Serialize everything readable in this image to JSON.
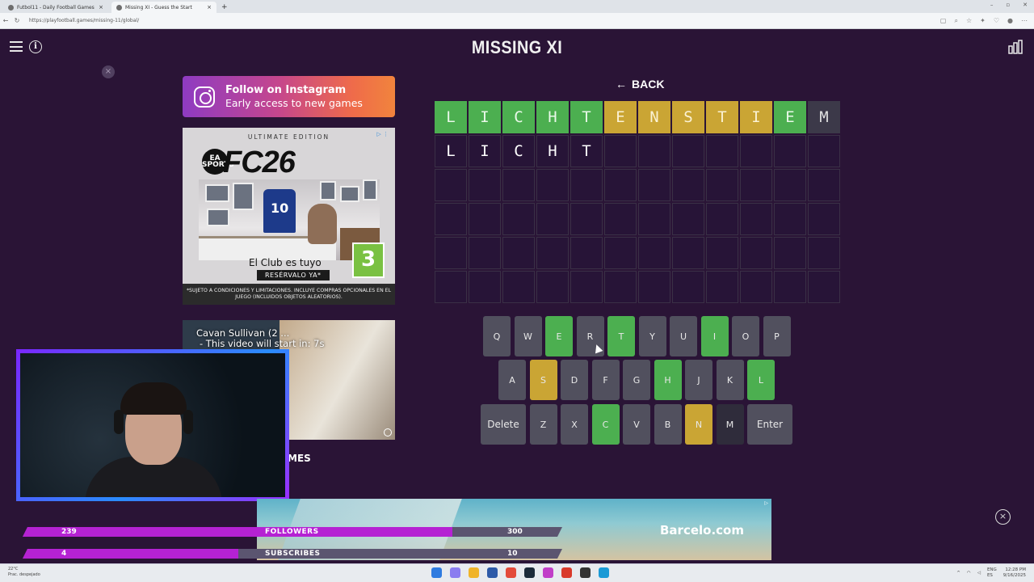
{
  "browser": {
    "tabs": [
      {
        "title": "Futbol11 - Daily Football Games"
      },
      {
        "title": "Missing XI - Guess the Start"
      }
    ],
    "url": "https://playfootball.games/missing-11/global/"
  },
  "header": {
    "title": "MISSING XI"
  },
  "instagram": {
    "title": "Follow on Instagram",
    "subtitle": "Early access to new games"
  },
  "ad": {
    "edition": "ULTIMATE EDITION",
    "ea": "EA SPORTS",
    "logo": "FC26",
    "claim": "El Club es tuyo",
    "cta": "RESÉRVALO YA*",
    "pegi": "3",
    "fine_print": "*SUJETO A CONDICIONES Y LIMITACIONES. INCLUYE COMPRAS OPCIONALES EN EL JUEGO (INCLUIDOS OBJETOS ALEATORIOS)."
  },
  "video": {
    "title": "Cavan Sullivan (2 ...",
    "countdown": "- This video will start in: 7s"
  },
  "games_label": "MES",
  "game": {
    "back_label": "BACK",
    "rows": [
      [
        {
          "l": "L",
          "s": "correct"
        },
        {
          "l": "I",
          "s": "correct"
        },
        {
          "l": "C",
          "s": "correct"
        },
        {
          "l": "H",
          "s": "correct"
        },
        {
          "l": "T",
          "s": "correct"
        },
        {
          "l": "E",
          "s": "present"
        },
        {
          "l": "N",
          "s": "present"
        },
        {
          "l": "S",
          "s": "present"
        },
        {
          "l": "T",
          "s": "present"
        },
        {
          "l": "I",
          "s": "present"
        },
        {
          "l": "E",
          "s": "correct"
        },
        {
          "l": "M",
          "s": "absent"
        }
      ],
      [
        {
          "l": "L",
          "s": "empty"
        },
        {
          "l": "I",
          "s": "empty"
        },
        {
          "l": "C",
          "s": "empty"
        },
        {
          "l": "H",
          "s": "empty"
        },
        {
          "l": "T",
          "s": "empty"
        },
        {
          "l": "",
          "s": "empty"
        },
        {
          "l": "",
          "s": "empty"
        },
        {
          "l": "",
          "s": "empty"
        },
        {
          "l": "",
          "s": "empty"
        },
        {
          "l": "",
          "s": "empty"
        },
        {
          "l": "",
          "s": "empty"
        },
        {
          "l": "",
          "s": "empty"
        }
      ]
    ],
    "empty_rows": 4,
    "columns": 12
  },
  "keyboard": {
    "rows": [
      [
        {
          "k": "Q",
          "s": "default"
        },
        {
          "k": "W",
          "s": "default"
        },
        {
          "k": "E",
          "s": "correct"
        },
        {
          "k": "R",
          "s": "default"
        },
        {
          "k": "T",
          "s": "correct"
        },
        {
          "k": "Y",
          "s": "default"
        },
        {
          "k": "U",
          "s": "default"
        },
        {
          "k": "I",
          "s": "correct"
        },
        {
          "k": "O",
          "s": "default"
        },
        {
          "k": "P",
          "s": "default"
        }
      ],
      [
        {
          "k": "A",
          "s": "default"
        },
        {
          "k": "S",
          "s": "present"
        },
        {
          "k": "D",
          "s": "default"
        },
        {
          "k": "F",
          "s": "default"
        },
        {
          "k": "G",
          "s": "default"
        },
        {
          "k": "H",
          "s": "correct"
        },
        {
          "k": "J",
          "s": "default"
        },
        {
          "k": "K",
          "s": "default"
        },
        {
          "k": "L",
          "s": "correct"
        }
      ],
      [
        {
          "k": "Delete",
          "s": "default"
        },
        {
          "k": "Z",
          "s": "default"
        },
        {
          "k": "X",
          "s": "default"
        },
        {
          "k": "C",
          "s": "correct"
        },
        {
          "k": "V",
          "s": "default"
        },
        {
          "k": "B",
          "s": "default"
        },
        {
          "k": "N",
          "s": "present"
        },
        {
          "k": "M",
          "s": "absent"
        },
        {
          "k": "Enter",
          "s": "default"
        }
      ]
    ]
  },
  "bottom_ad": {
    "brand": "Barcelo.com"
  },
  "stream": {
    "followers": {
      "current": "239",
      "label": "FOLLOWERS",
      "goal": "300",
      "progress": 0.797
    },
    "subscribes": {
      "current": "4",
      "label": "SUBSCRIBES",
      "goal": "10",
      "progress": 0.4
    }
  },
  "taskbar": {
    "weather_temp": "22°C",
    "weather_desc": "Prac. despejado",
    "lang": "ENG",
    "lang2": "ES",
    "time": "12:28 PM",
    "date": "9/16/2025"
  },
  "colors": {
    "background": "#2a1436",
    "correct": "#4caf50",
    "present": "#caa534",
    "absent": "#2f2c3b",
    "stream_fill": "#b522d3"
  }
}
